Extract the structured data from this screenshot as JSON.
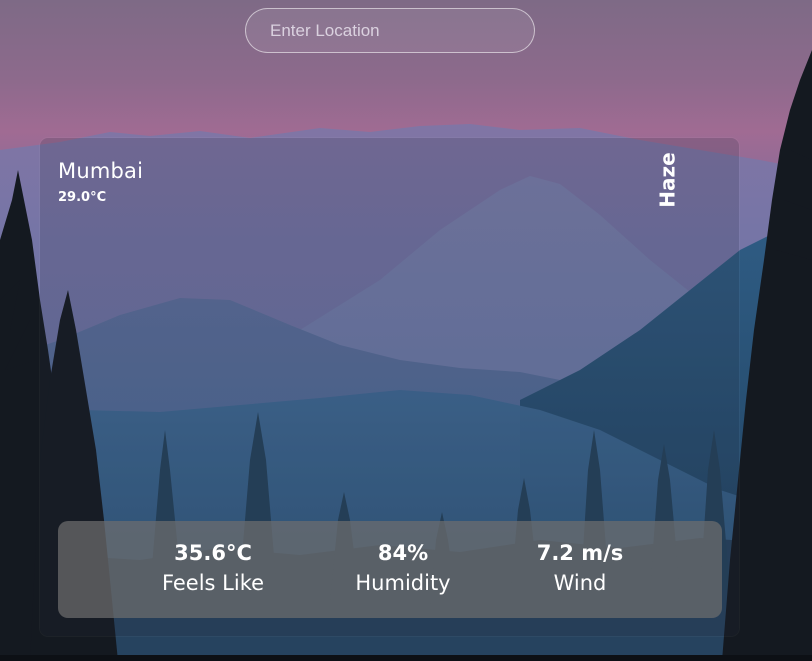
{
  "search": {
    "placeholder": "Enter Location",
    "value": ""
  },
  "weather": {
    "city": "Mumbai",
    "temperature": "29.0°C",
    "condition": "Haze"
  },
  "stats": {
    "feels_like": {
      "value": "35.6°C",
      "label": "Feels Like"
    },
    "humidity": {
      "value": "84%",
      "label": "Humidity"
    },
    "wind": {
      "value": "7.2 m/s",
      "label": "Wind"
    }
  },
  "colors": {
    "sky_top": "#8a6a8e",
    "sky_pink": "#a06a93",
    "mountain_far": "#6d79a8",
    "valley_blue": "#3f6a93",
    "forest_dark": "#151a20",
    "stats_panel": "#6e6e6e"
  }
}
